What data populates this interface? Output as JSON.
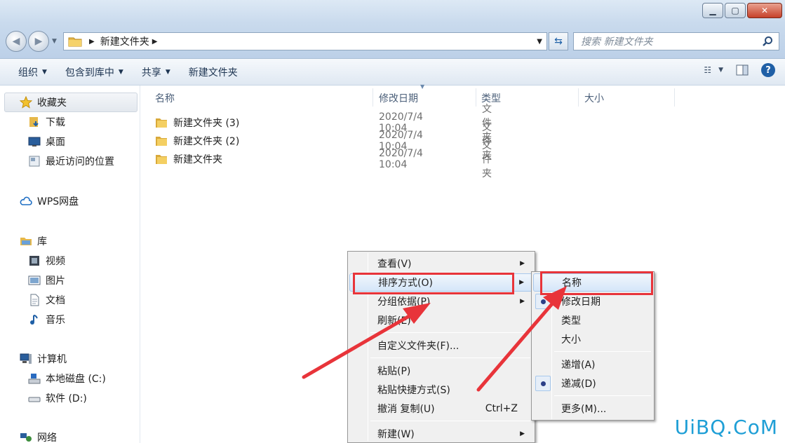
{
  "address": {
    "path_item": "新建文件夹",
    "search_placeholder": "搜索 新建文件夹"
  },
  "toolbar": {
    "organize": "组织",
    "include_library": "包含到库中",
    "share": "共享",
    "new_folder": "新建文件夹"
  },
  "sidebar": {
    "favorites": "收藏夹",
    "downloads": "下载",
    "desktop": "桌面",
    "recent": "最近访问的位置",
    "wps": "WPS网盘",
    "library": "库",
    "videos": "视频",
    "pictures": "图片",
    "documents": "文档",
    "music": "音乐",
    "computer": "计算机",
    "drive_c": "本地磁盘 (C:)",
    "drive_d": "软件 (D:)",
    "network": "网络"
  },
  "columns": {
    "name": "名称",
    "date": "修改日期",
    "type": "类型",
    "size": "大小"
  },
  "files": [
    {
      "name": "新建文件夹 (3)",
      "date": "2020/7/4 10:04",
      "type": "文件夹"
    },
    {
      "name": "新建文件夹 (2)",
      "date": "2020/7/4 10:04",
      "type": "文件夹"
    },
    {
      "name": "新建文件夹",
      "date": "2020/7/4 10:04",
      "type": "文件夹"
    }
  ],
  "context_menu": {
    "view": "查看(V)",
    "sort_by": "排序方式(O)",
    "group_by": "分组依据(P)",
    "refresh": "刷新(E)",
    "customize": "自定义文件夹(F)...",
    "paste": "粘贴(P)",
    "paste_shortcut": "粘贴快捷方式(S)",
    "undo_copy": "撤消 复制(U)",
    "undo_shortcut": "Ctrl+Z",
    "new": "新建(W)"
  },
  "sort_submenu": {
    "name": "名称",
    "date": "修改日期",
    "type": "类型",
    "size": "大小",
    "ascending": "递增(A)",
    "descending": "递减(D)",
    "more": "更多(M)..."
  },
  "watermark": "UiBQ.CoM",
  "colors": {
    "highlight_red": "#e8343a",
    "accent_blue": "#1f5fa6"
  }
}
